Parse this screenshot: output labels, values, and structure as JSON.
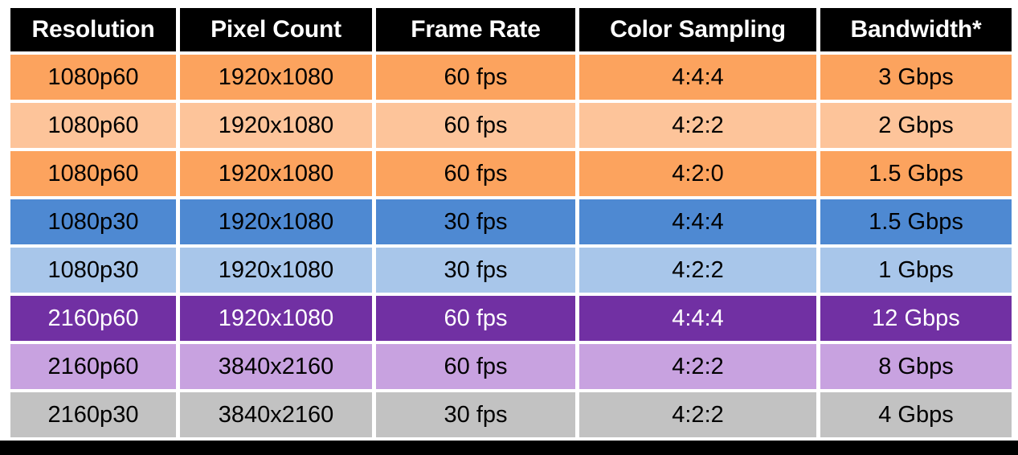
{
  "table": {
    "columns": [
      "Resolution",
      "Pixel Count",
      "Frame Rate",
      "Color Sampling",
      "Bandwidth*"
    ],
    "rows": [
      {
        "resolution": "1080p60",
        "pixel_count": "1920x1080",
        "frame_rate": "60 fps",
        "color_sampling": "4:4:4",
        "bandwidth": "3 Gbps",
        "row_style": "row-orange-dark",
        "bg_color": "#FCA35E",
        "text_color": "#000000"
      },
      {
        "resolution": "1080p60",
        "pixel_count": "1920x1080",
        "frame_rate": "60 fps",
        "color_sampling": "4:2:2",
        "bandwidth": "2 Gbps",
        "row_style": "row-orange-light",
        "bg_color": "#FDC49A",
        "text_color": "#000000"
      },
      {
        "resolution": "1080p60",
        "pixel_count": "1920x1080",
        "frame_rate": "60 fps",
        "color_sampling": "4:2:0",
        "bandwidth": "1.5 Gbps",
        "row_style": "row-orange-dark",
        "bg_color": "#FCA35E",
        "text_color": "#000000"
      },
      {
        "resolution": "1080p30",
        "pixel_count": "1920x1080",
        "frame_rate": "30 fps",
        "color_sampling": "4:4:4",
        "bandwidth": "1.5 Gbps",
        "row_style": "row-blue-dark",
        "bg_color": "#4E89D2",
        "text_color": "#000000"
      },
      {
        "resolution": "1080p30",
        "pixel_count": "1920x1080",
        "frame_rate": "30 fps",
        "color_sampling": "4:2:2",
        "bandwidth": "1 Gbps",
        "row_style": "row-blue-light",
        "bg_color": "#A8C6EA",
        "text_color": "#000000"
      },
      {
        "resolution": "2160p60",
        "pixel_count": "1920x1080",
        "frame_rate": "60 fps",
        "color_sampling": "4:4:4",
        "bandwidth": "12 Gbps",
        "row_style": "row-purple-dark",
        "bg_color": "#7130A3",
        "text_color": "#FFFFFF"
      },
      {
        "resolution": "2160p60",
        "pixel_count": "3840x2160",
        "frame_rate": "60 fps",
        "color_sampling": "4:2:2",
        "bandwidth": "8 Gbps",
        "row_style": "row-purple-light",
        "bg_color": "#C8A2E0",
        "text_color": "#000000"
      },
      {
        "resolution": "2160p30",
        "pixel_count": "3840x2160",
        "frame_rate": "30 fps",
        "color_sampling": "4:2:2",
        "bandwidth": "4 Gbps",
        "row_style": "row-gray",
        "bg_color": "#C2C2C2",
        "text_color": "#000000"
      }
    ]
  },
  "theme": {
    "header_bg": "#000000",
    "header_text": "#FFFFFF",
    "page_bg": "#FFFFFF",
    "frame_color": "#000000"
  }
}
